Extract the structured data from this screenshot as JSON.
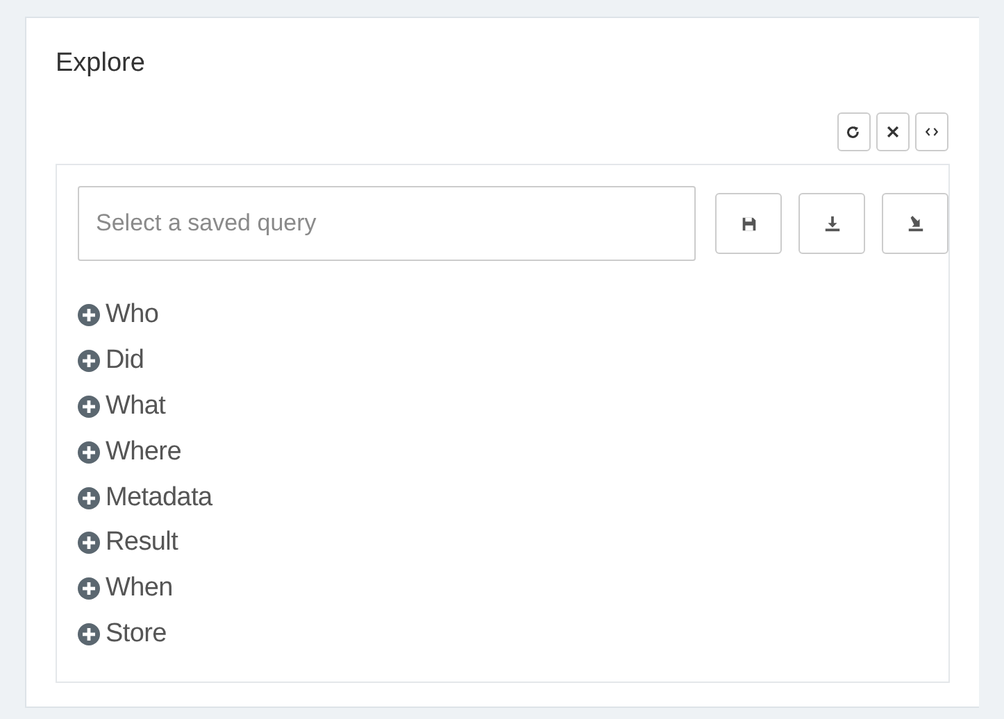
{
  "panel": {
    "title": "Explore"
  },
  "panel_tools": [
    {
      "kind": "refresh"
    },
    {
      "kind": "close"
    },
    {
      "kind": "code"
    }
  ],
  "query": {
    "placeholder": "Select a saved query"
  },
  "query_actions": [
    {
      "kind": "save"
    },
    {
      "kind": "download"
    },
    {
      "kind": "import"
    }
  ],
  "tree": [
    {
      "label": "Who",
      "expanded": false
    },
    {
      "label": "Did",
      "expanded": false
    },
    {
      "label": "What",
      "expanded": false
    },
    {
      "label": "Where",
      "expanded": false
    },
    {
      "label": "Metadata",
      "expanded": false
    },
    {
      "label": "Result",
      "expanded": false
    },
    {
      "label": "When",
      "expanded": false
    },
    {
      "label": "Store",
      "expanded": false
    }
  ]
}
